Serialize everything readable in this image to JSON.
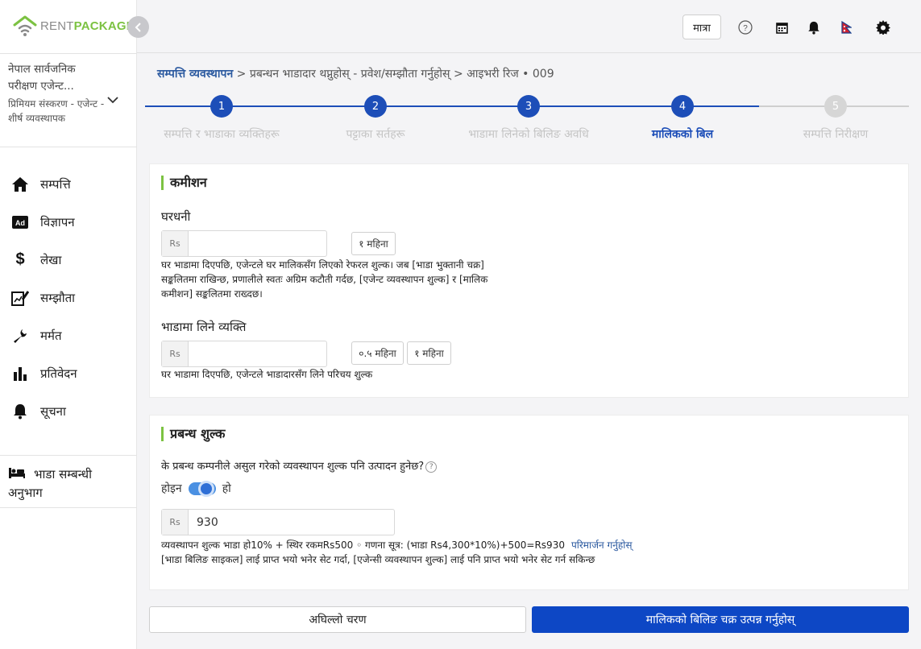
{
  "app": {
    "logo_part1": "RENT",
    "logo_part2": "PACKAGE",
    "brand_green": "#7cc242",
    "accent_blue": "#0d47c5"
  },
  "sidebar": {
    "org_name": "नेपाल सार्वजनिक परीक्षण एजेन्ट...",
    "org_plan": "प्रिमियम संस्करण - एजेन्ट - शीर्ष व्यवस्थापक",
    "items": [
      {
        "label": "सम्पत्ति",
        "icon": "home-icon"
      },
      {
        "label": "विज्ञापन",
        "icon": "ad-icon"
      },
      {
        "label": "लेखा",
        "icon": "dollar-icon"
      },
      {
        "label": "सम्झौता",
        "icon": "contract-icon"
      },
      {
        "label": "मर्मत",
        "icon": "wrench-icon"
      },
      {
        "label": "प्रतिवेदन",
        "icon": "bar-chart-icon"
      },
      {
        "label": "सूचना",
        "icon": "bell-icon"
      }
    ],
    "rental_experience": "भाडा सम्बन्धी अनुभाग"
  },
  "topbar": {
    "matra_label": "मात्रा",
    "icons": [
      "help-icon",
      "calendar-icon",
      "notification-bell-icon",
      "nepal-flag-icon",
      "gear-icon"
    ]
  },
  "breadcrumb": {
    "root": "सम्पत्ति व्यवस्थापन",
    "rest": " > प्रबन्धन भाडादार थप्नुहोस् - प्रवेश/सम्झौता गर्नुहोस् > आइभरी रिज • 009"
  },
  "stepper": {
    "steps": [
      {
        "num": "1",
        "label": "सम्पत्ति र भाडाका व्यक्तिहरू",
        "state": "done"
      },
      {
        "num": "2",
        "label": "पट्टाका सर्तहरू",
        "state": "done"
      },
      {
        "num": "3",
        "label": "भाडामा लिनेको बिलिङ अवधि",
        "state": "done"
      },
      {
        "num": "4",
        "label": "मालिकको बिल",
        "state": "active"
      },
      {
        "num": "5",
        "label": "सम्पत्ति निरीक्षण",
        "state": "pending"
      }
    ]
  },
  "commission": {
    "title": "कमीशन",
    "landlord": {
      "label": "घरधनी",
      "currency": "Rs",
      "value": "",
      "chips": [
        "१ महिना"
      ],
      "help": [
        "घर भाडामा दिएपछि, एजेन्टले घर मालिकसँग लिएको रेफरल शुल्क। जब [भाडा भुक्तानी चक्र]",
        "सङ्कलितमा राखिन्छ, प्रणालीले स्वतः अग्रिम कटौती गर्दछ, [एजेन्ट व्यवस्थापन शुल्क] र [मालिक",
        "कमीशन] सङ्कलितमा राख्दछ।"
      ]
    },
    "tenant": {
      "label": "भाडामा लिने व्यक्ति",
      "currency": "Rs",
      "value": "",
      "chips": [
        "०.५ महिना",
        "१ महिना"
      ],
      "help": "घर भाडामा दिएपछि, एजेन्टले भाडादारसँग लिने परिचय शुल्क"
    }
  },
  "management_fee": {
    "title": "प्रबन्ध शुल्क",
    "question": "के प्रबन्ध कम्पनीले असुल गरेको व्यवस्थापन शुल्क पनि उत्पादन हुनेछ?",
    "toggle_off": "होइन",
    "toggle_on": "हो",
    "toggle_state": "on",
    "currency": "Rs",
    "value": "930",
    "formula": "व्यवस्थापन शुल्क भाडा हो10% + स्थिर रकमRs500 ◦ गणना सूत्र: (भाडा Rs4,300*10%)+500=Rs930",
    "customize_link": "परिमार्जन गर्नुहोस्",
    "note": "[भाडा बिलिङ साइकल] लाई प्राप्त भयो भनेर सेट गर्दा, [एजेन्सी व्यवस्थापन शुल्क] लाई पनि प्राप्त भयो भनेर सेट गर्न सकिन्छ"
  },
  "footer": {
    "prev_label": "अघिल्लो चरण",
    "next_label": "मालिकको बिलिङ चक्र उत्पन्न गर्नुहोस्"
  }
}
